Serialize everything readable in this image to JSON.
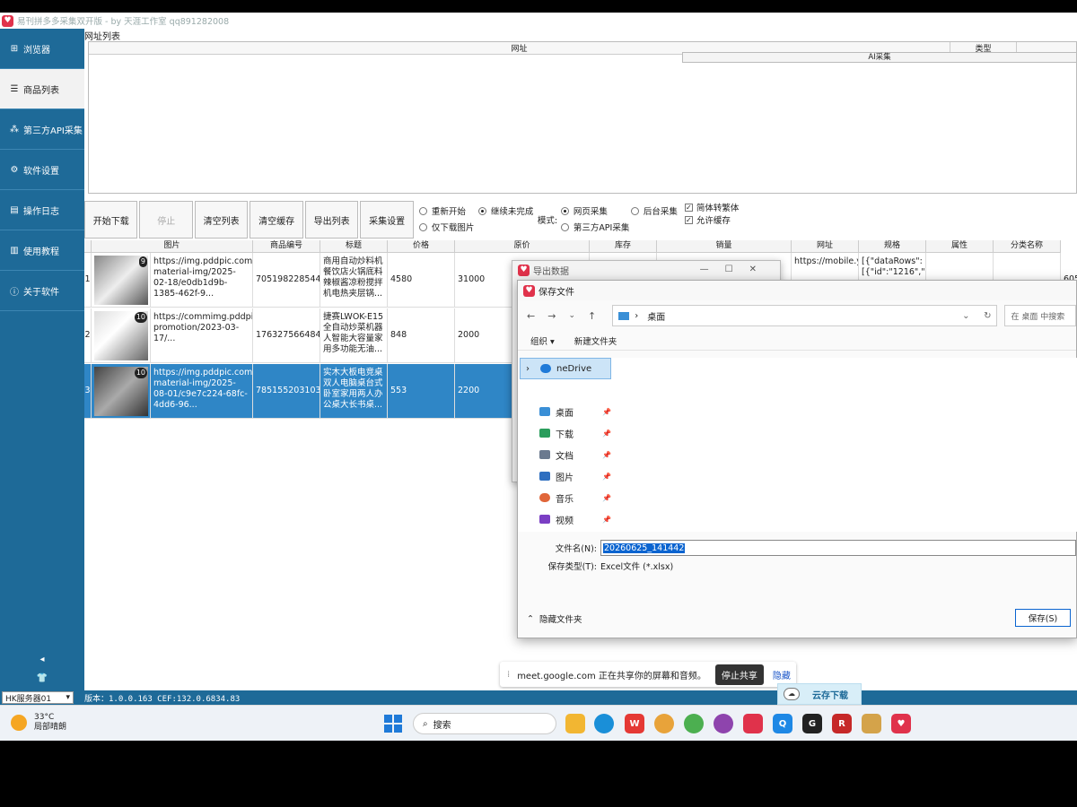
{
  "app": {
    "title": "易刊拼多多采集双开版 - by 天涯工作室 qq891282008"
  },
  "sidebar": {
    "items": [
      {
        "label": "浏览器",
        "icon": "grid-icon"
      },
      {
        "label": "商品列表",
        "icon": "list-icon"
      },
      {
        "label": "第三方API采集",
        "icon": "network-icon"
      },
      {
        "label": "软件设置",
        "icon": "gear-icon"
      },
      {
        "label": "操作日志",
        "icon": "document-icon"
      },
      {
        "label": "使用教程",
        "icon": "book-icon"
      },
      {
        "label": "关于软件",
        "icon": "info-icon"
      }
    ],
    "collapse_glyph": "◂",
    "shirt_glyph": "👕"
  },
  "url_panel": {
    "label": "网址列表",
    "columns": [
      "网址",
      "类型"
    ]
  },
  "toolbar": {
    "start": "开始下载",
    "stop": "停止",
    "clear_list": "清空列表",
    "clear_cache": "清空缓存",
    "export": "导出列表",
    "settings": "采集设置",
    "restart": "重新开始",
    "continue": "继续未完成",
    "images_only": "仅下载图片",
    "mode_label": "模式:",
    "mode_web": "网页采集",
    "mode_api": "第三方API采集",
    "mode_bg": "后台采集",
    "simp_to_trad": "简体转繁体",
    "allow_cache": "允许缓存",
    "ai_label": "AI采集"
  },
  "grid": {
    "columns": [
      "图片",
      "商品编号",
      "标题",
      "价格",
      "原价",
      "库存",
      "销量",
      "网址",
      "规格",
      "属性",
      "分类名称"
    ],
    "rows": [
      {
        "index": "1",
        "badge": "9",
        "url": "https://img.pddpic.com/mms-material-img/2025-02-18/e0db1d9b-1385-462f-9...",
        "id": "705198228544",
        "title": "商用自动炒料机餐饮店火锅底料辣椒酱凉粉搅拌机电热夹层锅...",
        "price": "4580",
        "orig": "31000",
        "link": "https://mobile.yangk...",
        "spec": "[{\"dataRows\":[{\"id\":\"1216\",\"...",
        "extra": "605"
      },
      {
        "index": "2",
        "badge": "10",
        "url": "https://commimg.pddpic.com/ad-promotion/2023-03-17/...",
        "id": "176327566484",
        "title": "捷赛LWOK-E15全自动炒菜机器人智能大容量家用多功能无油...",
        "price": "848",
        "orig": "2000"
      },
      {
        "index": "3",
        "badge": "10",
        "url": "https://img.pddpic.com/mms-material-img/2025-08-01/c9e7c224-68fc-4dd6-96...",
        "id": "785155203103",
        "title": "实木大板电竞桌双人电脑桌台式卧室家用两人办公桌大长书桌...",
        "price": "553",
        "orig": "2200"
      }
    ]
  },
  "export_dialog": {
    "title": "导出数据"
  },
  "save_dialog": {
    "title": "保存文件",
    "path": "桌面",
    "search_placeholder": "在 桌面 中搜索",
    "organize": "组织 ▾",
    "new_folder": "新建文件夹",
    "tree": [
      {
        "label": "neDrive",
        "icon": "onedrive-icon",
        "color": "#1f7ad8"
      },
      {
        "label": "桌面",
        "icon": "desktop-icon",
        "color": "#3a8fd6"
      },
      {
        "label": "下载",
        "icon": "download-icon",
        "color": "#2a9d5c"
      },
      {
        "label": "文档",
        "icon": "documents-icon",
        "color": "#6b7a8f"
      },
      {
        "label": "图片",
        "icon": "pictures-icon",
        "color": "#2f6fc0"
      },
      {
        "label": "音乐",
        "icon": "music-icon",
        "color": "#e0663a"
      },
      {
        "label": "视频",
        "icon": "video-icon",
        "color": "#7b3fc4"
      }
    ],
    "filename_label": "文件名(N):",
    "filename_value": "20260625_141442",
    "filetype_label": "保存类型(T):",
    "filetype_value": "Excel文件 (*.xlsx)",
    "hide_folders": "隐藏文件夹",
    "save_button": "保存(S)"
  },
  "status": {
    "server": "HK服务器01",
    "version": "版本：1.0.0.163 CEF:132.0.6834.83"
  },
  "cloud_download": "云存下载",
  "share_bar": {
    "text": "meet.google.com 正在共享你的屏幕和音频。",
    "stop": "停止共享",
    "hide": "隐藏"
  },
  "taskbar": {
    "temp": "33°C",
    "weather": "局部晴朗",
    "search": "搜索"
  }
}
